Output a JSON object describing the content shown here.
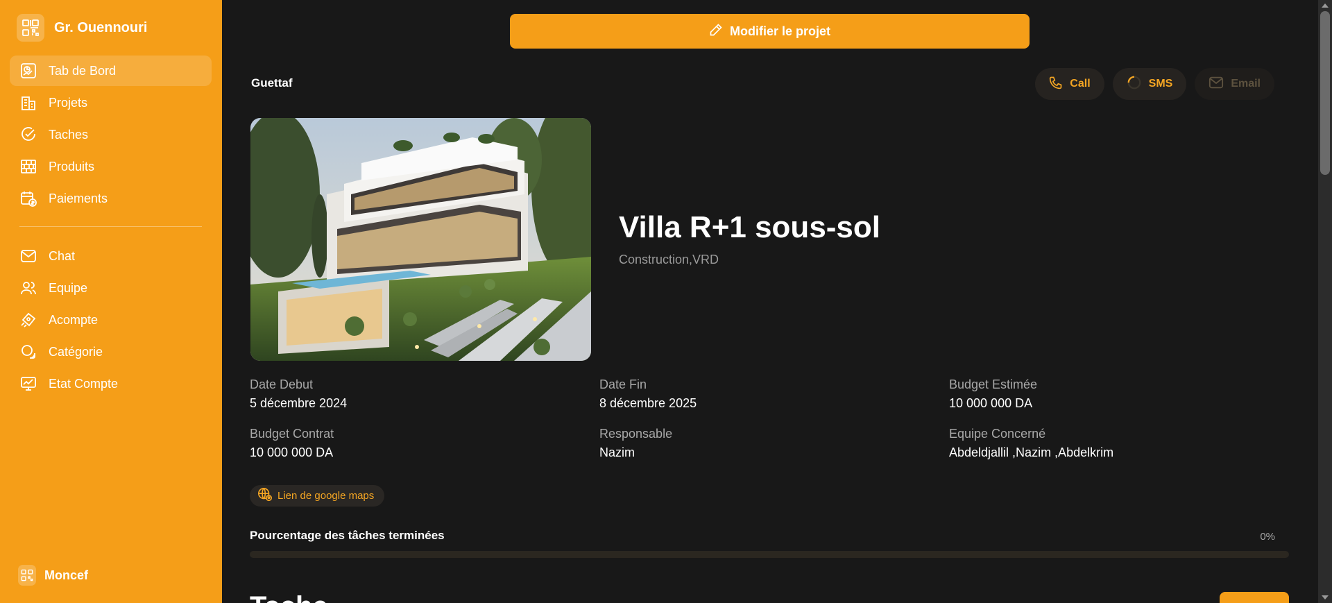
{
  "sidebar": {
    "brand_name": "Gr. Ouennouri",
    "items": [
      {
        "label": "Tab de Bord",
        "icon": "dashboard-icon"
      },
      {
        "label": "Projets",
        "icon": "buildings-icon"
      },
      {
        "label": "Taches",
        "icon": "check-circle-icon"
      },
      {
        "label": "Produits",
        "icon": "bricks-icon"
      },
      {
        "label": "Paiements",
        "icon": "calendar-dollar-icon"
      }
    ],
    "items2": [
      {
        "label": "Chat",
        "icon": "mail-icon"
      },
      {
        "label": "Equipe",
        "icon": "users-icon"
      },
      {
        "label": "Acompte",
        "icon": "money-hand-icon"
      },
      {
        "label": "Catégorie",
        "icon": "category-icon"
      },
      {
        "label": "Etat Compte",
        "icon": "monitor-chart-icon"
      }
    ],
    "user_name": "Moncef"
  },
  "main": {
    "edit_button": "Modifier le projet",
    "client_name": "Guettaf",
    "contact": {
      "call": "Call",
      "sms": "SMS",
      "email": "Email"
    },
    "project_title": "Villa R+1 sous-sol",
    "project_categories": "Construction,VRD",
    "info": [
      {
        "label": "Date Debut",
        "value": "5 décembre 2024"
      },
      {
        "label": "Date Fin",
        "value": "8 décembre 2025"
      },
      {
        "label": "Budget Estimée",
        "value": "10 000 000 DA"
      },
      {
        "label": "Budget Contrat",
        "value": "10 000 000 DA"
      },
      {
        "label": "Responsable",
        "value": "Nazim"
      },
      {
        "label": "Equipe Concerné",
        "value": "Abdeldjallil ,Nazim ,Abdelkrim"
      }
    ],
    "maps_link": "Lien de google maps",
    "progress_title": "Pourcentage des tâches terminées",
    "progress_value": 0,
    "progress_label": "0%",
    "section_title": "Tache"
  },
  "colors": {
    "accent": "#F59E18",
    "background": "#181818"
  }
}
